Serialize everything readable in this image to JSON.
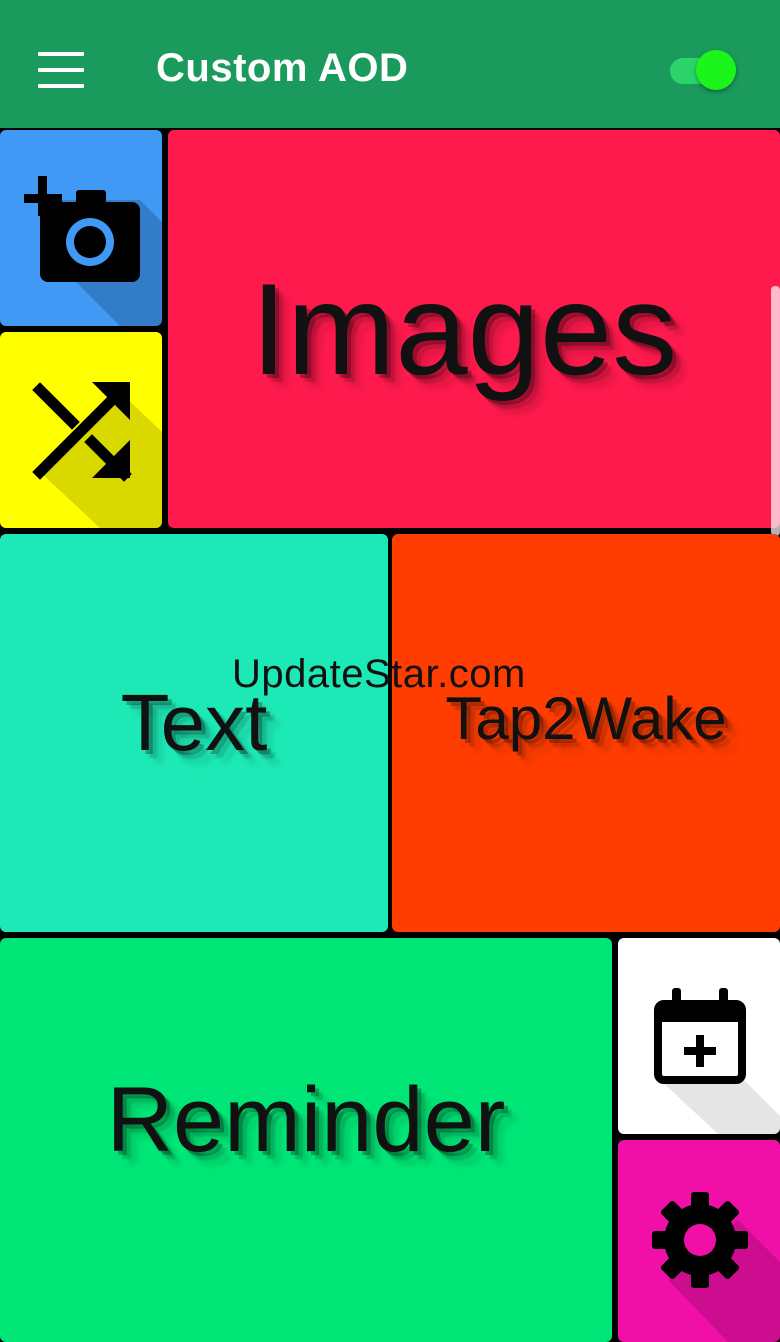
{
  "app": {
    "title": "Custom AOD",
    "menu_icon": "menu-icon",
    "enabled": true,
    "accent_color": "#1a9a5c"
  },
  "tiles": {
    "add_image": {
      "icon": "add-photo-icon",
      "color": "#3f99f5"
    },
    "shuffle": {
      "icon": "shuffle-icon",
      "color": "#ffff00"
    },
    "images": {
      "label": "Images",
      "color": "#ff1a4d"
    },
    "text": {
      "label": "Text",
      "color": "#1de9b6"
    },
    "tap2wake": {
      "label": "Tap2Wake",
      "color": "#ff3d00"
    },
    "reminder": {
      "label": "Reminder",
      "color": "#00e676"
    },
    "add_event": {
      "icon": "calendar-add-icon",
      "color": "#ffffff"
    },
    "settings": {
      "icon": "gear-icon",
      "color": "#f010a8"
    }
  },
  "watermark": "UpdateStar.com"
}
